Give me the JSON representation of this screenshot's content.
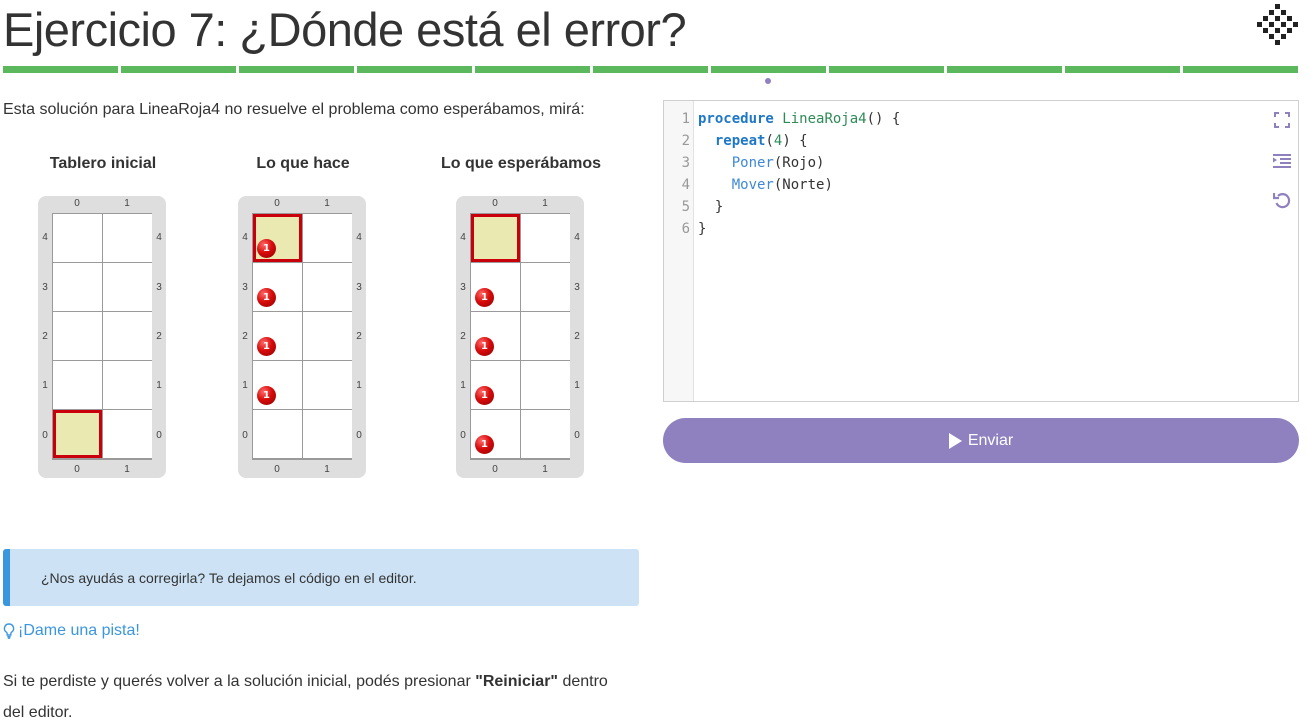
{
  "header": {
    "title": "Ejercicio 7: ¿Dónde está el error?",
    "progress_segments": 11,
    "progress_color": "#5cb85c",
    "accent_color": "#8f80bf"
  },
  "intro": "Esta solución para LineaRoja4 no resuelve el problema como esperábamos, mirá:",
  "boards": [
    {
      "caption": "Tablero inicial",
      "cols": [
        "0",
        "1"
      ],
      "rows": [
        "4",
        "3",
        "2",
        "1",
        "0"
      ],
      "head": [
        0,
        0
      ],
      "balls": []
    },
    {
      "caption": "Lo que hace",
      "cols": [
        "0",
        "1"
      ],
      "rows": [
        "4",
        "3",
        "2",
        "1",
        "0"
      ],
      "head": [
        0,
        4
      ],
      "balls": [
        {
          "x": 0,
          "y": 4,
          "count": "1"
        },
        {
          "x": 0,
          "y": 3,
          "count": "1"
        },
        {
          "x": 0,
          "y": 2,
          "count": "1"
        },
        {
          "x": 0,
          "y": 1,
          "count": "1"
        }
      ]
    },
    {
      "caption": "Lo que esperábamos",
      "cols": [
        "0",
        "1"
      ],
      "rows": [
        "4",
        "3",
        "2",
        "1",
        "0"
      ],
      "head": [
        0,
        4
      ],
      "balls": [
        {
          "x": 0,
          "y": 3,
          "count": "1"
        },
        {
          "x": 0,
          "y": 2,
          "count": "1"
        },
        {
          "x": 0,
          "y": 1,
          "count": "1"
        },
        {
          "x": 0,
          "y": 0,
          "count": "1"
        }
      ]
    }
  ],
  "editor": {
    "line_numbers": [
      "1",
      "2",
      "3",
      "4",
      "5",
      "6"
    ],
    "code": {
      "l1_kw": "procedure",
      "l1_name": "LineaRoja4",
      "l1_rest": "() {",
      "l2_kw": "repeat",
      "l2_open": "(",
      "l2_num": "4",
      "l2_rest": ") {",
      "l3_fn": "Poner",
      "l3_rest": "(Rojo)",
      "l4_fn": "Mover",
      "l4_rest": "(Norte)",
      "l5": "}",
      "l6": "}"
    },
    "tools": [
      "fullscreen-icon",
      "indent-icon",
      "reset-icon"
    ]
  },
  "send_button": "Enviar",
  "alert": "¿Nos ayudás a corregirla? Te dejamos el código en el editor.",
  "hint": "¡Dame una pista!",
  "reset_text": {
    "before": "Si te perdiste y querés volver a la solución inicial, podés presionar ",
    "strong": "\"Reiniciar\"",
    "after": " dentro del editor."
  }
}
